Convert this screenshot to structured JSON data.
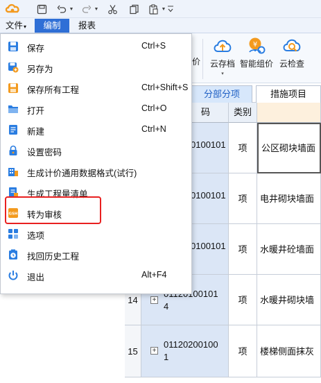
{
  "menu": {
    "tabs": [
      {
        "label": "文件",
        "arrow": "▾"
      },
      {
        "label": "编制"
      },
      {
        "label": "报表"
      }
    ]
  },
  "ribbon": {
    "partial_label": "价",
    "buttons": [
      {
        "label": "云存档",
        "icon": "cloud-upload-icon",
        "arrow": "▾"
      },
      {
        "label": "智能组价",
        "icon": "smart-pricing-icon"
      },
      {
        "label": "云检查",
        "icon": "cloud-check-icon"
      }
    ]
  },
  "content_tabs": [
    "分部分项",
    "措施项目"
  ],
  "grid": {
    "headers": {
      "code_partial": "码",
      "type": "类别"
    },
    "rows": [
      {
        "num": "",
        "code": "0100101",
        "type": "项",
        "name": "公区砌块墙面"
      },
      {
        "num": "",
        "code": "0100101",
        "type": "项",
        "name": "电井砌块墙面"
      },
      {
        "num": "",
        "code": "0100101",
        "type": "项",
        "name": "水暖井砼墙面"
      },
      {
        "num": "14",
        "code_line1": "01120100101",
        "code_line2": "4",
        "type": "项",
        "name": "水暖井砌块墙"
      },
      {
        "num": "15",
        "code_line1": "01120200100",
        "code_line2": "1",
        "type": "项",
        "name": "楼梯侧面抹灰"
      }
    ]
  },
  "file_menu": {
    "items": [
      {
        "label": "保存",
        "shortcut": "Ctrl+S",
        "icon": "save-icon"
      },
      {
        "label": "另存为",
        "shortcut": "",
        "icon": "save-as-icon"
      },
      {
        "label": "保存所有工程",
        "shortcut": "Ctrl+Shift+S",
        "icon": "save-all-icon"
      },
      {
        "label": "打开",
        "shortcut": "Ctrl+O",
        "icon": "open-folder-icon"
      },
      {
        "label": "新建",
        "shortcut": "Ctrl+N",
        "icon": "new-file-icon"
      },
      {
        "label": "设置密码",
        "shortcut": "",
        "icon": "lock-icon"
      },
      {
        "label": "生成计价通用数据格式(试行)",
        "shortcut": "",
        "icon": "export-data-icon"
      },
      {
        "label": "生成工程量清单",
        "shortcut": "",
        "icon": "bill-quantity-icon"
      },
      {
        "label": "转为审核",
        "shortcut": "",
        "icon": "convert-audit-icon",
        "badge": "GSH"
      },
      {
        "label": "选项",
        "shortcut": "",
        "icon": "options-grid-icon"
      },
      {
        "label": "找回历史工程",
        "shortcut": "",
        "icon": "history-icon"
      },
      {
        "label": "退出",
        "shortcut": "Alt+F4",
        "icon": "power-icon"
      }
    ]
  },
  "colors": {
    "accent": "#2f6fd6",
    "highlight_box": "#e82020",
    "menu_icon_blue": "#2a7de1",
    "menu_icon_orange": "#f39a1e"
  }
}
